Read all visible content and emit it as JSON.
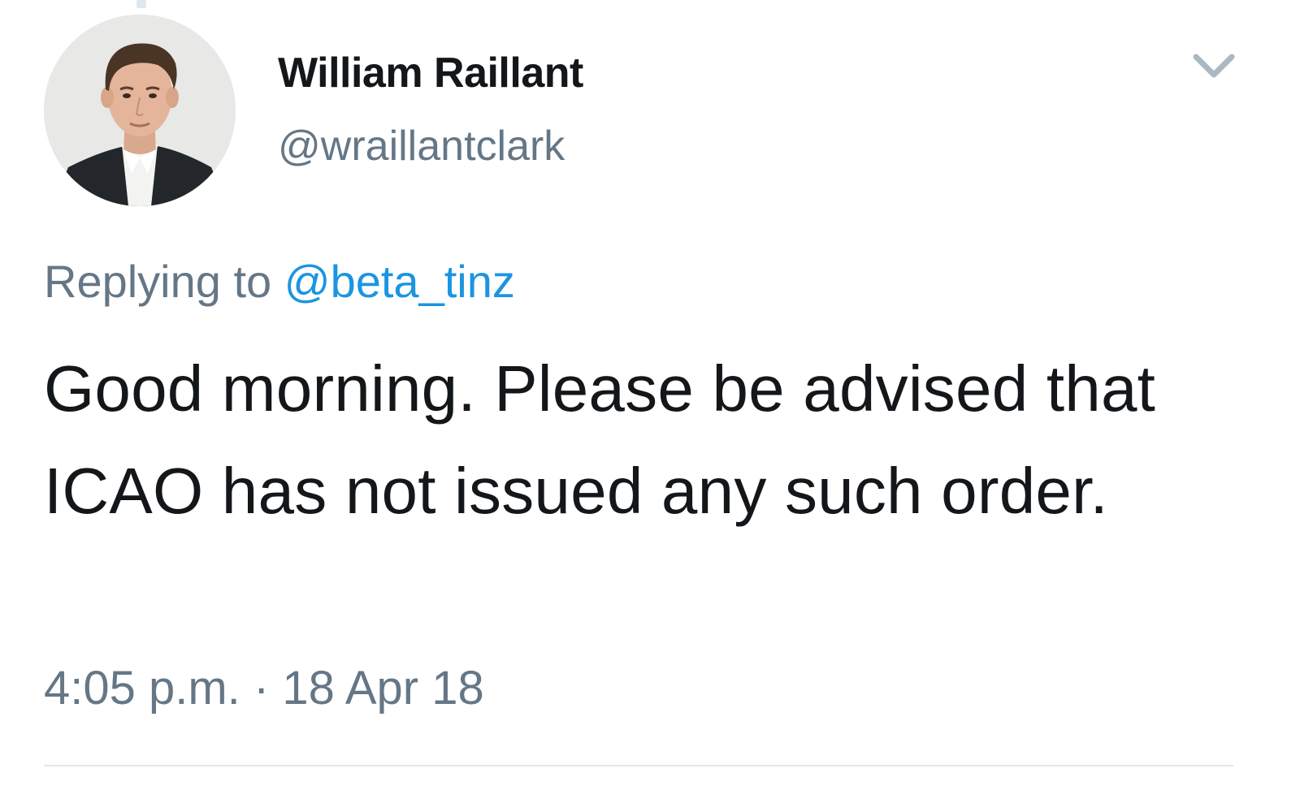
{
  "tweet": {
    "author": {
      "display_name": "William Raillant",
      "handle": "@wraillantclark",
      "avatar_icon": "profile-photo"
    },
    "more_icon": "chevron-down-icon",
    "reply": {
      "prefix": "Replying to",
      "handle": "@beta_tinz"
    },
    "text": "Good morning. Please be advised that ICAO has not issued any such order.",
    "meta": {
      "time": "4:05 p.m.",
      "separator": "·",
      "date": "18 Apr 18"
    }
  },
  "colors": {
    "text_primary": "#14171a",
    "text_secondary": "#657786",
    "link_blue": "#1b95e0",
    "divider": "#e1e8ed",
    "chevron": "#aab8c2"
  }
}
